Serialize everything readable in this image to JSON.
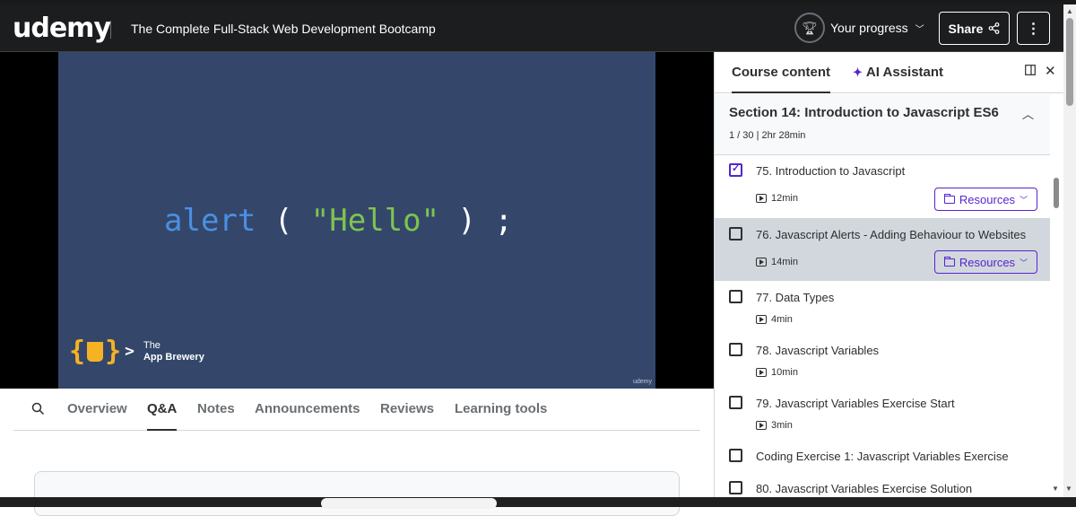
{
  "header": {
    "logo": "udemy",
    "course_title": "The Complete Full-Stack Web Development Bootcamp",
    "progress_label": "Your progress",
    "share_label": "Share",
    "more_label": "⋮"
  },
  "video": {
    "code_keyword": "alert",
    "code_open": " ( ",
    "code_string": "\"Hello\"",
    "code_close": " ) ;",
    "brand_line1": "The",
    "brand_line2": "App Brewery",
    "watermark": "udemy"
  },
  "tabs": {
    "items": [
      "Overview",
      "Q&A",
      "Notes",
      "Announcements",
      "Reviews",
      "Learning tools"
    ],
    "active": "Q&A"
  },
  "sidebar": {
    "tab_content": "Course content",
    "tab_ai": "AI Assistant",
    "section": {
      "title": "Section 14: Introduction to Javascript ES6",
      "meta": "1 / 30 | 2hr 28min"
    },
    "lectures": [
      {
        "title": "75. Introduction to Javascript",
        "duration": "12min",
        "resources": "Resources",
        "checked": true
      },
      {
        "title": "76. Javascript Alerts - Adding Behaviour to Websites",
        "duration": "14min",
        "resources": "Resources",
        "checked": false
      },
      {
        "title": "77. Data Types",
        "duration": "4min",
        "checked": false
      },
      {
        "title": "78. Javascript Variables",
        "duration": "10min",
        "checked": false
      },
      {
        "title": "79. Javascript Variables Exercise Start",
        "duration": "3min",
        "checked": false
      },
      {
        "title": "Coding Exercise 1: Javascript Variables Exercise",
        "checked": false
      },
      {
        "title": "80. Javascript Variables Exercise Solution",
        "checked": false
      }
    ]
  },
  "colors": {
    "header_bg": "#1c1d1f",
    "video_bg": "#34476b",
    "accent": "#5624d0",
    "current_row": "#d1d7dc"
  }
}
